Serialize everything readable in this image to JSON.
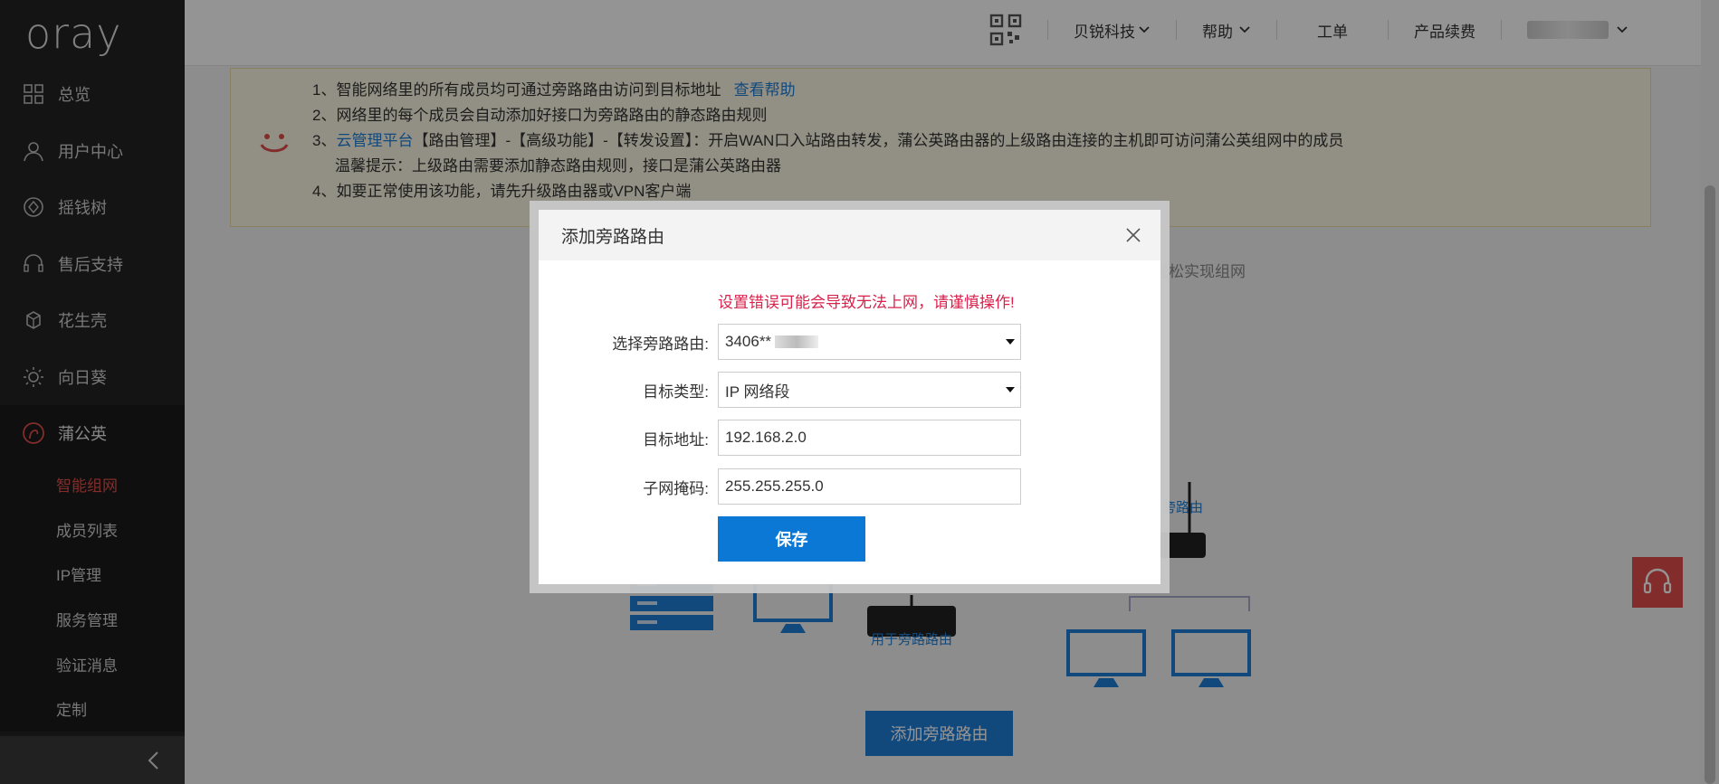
{
  "sidebar": {
    "logo": "oray",
    "items": [
      {
        "label": "总览",
        "icon": "grid-icon"
      },
      {
        "label": "用户中心",
        "icon": "user-icon"
      },
      {
        "label": "摇钱树",
        "icon": "coin-icon"
      },
      {
        "label": "售后支持",
        "icon": "headset-icon"
      },
      {
        "label": "花生壳",
        "icon": "shell-icon"
      },
      {
        "label": "向日葵",
        "icon": "sunflower-icon"
      },
      {
        "label": "蒲公英",
        "icon": "dandelion-icon"
      }
    ],
    "sub_items": [
      "智能组网",
      "成员列表",
      "IP管理",
      "服务管理",
      "验证消息",
      "定制"
    ],
    "active_sub": "智能组网"
  },
  "topbar": {
    "company": "贝锐科技",
    "help": "帮助",
    "ticket": "工单",
    "renew": "产品续费"
  },
  "notice": {
    "line1_text": "1、智能网络里的所有成员均可通过旁路路由访问到目标地址",
    "line1_link": "查看帮助",
    "line2": "2、网络里的每个成员会自动添加好接口为旁路路由的静态路由规则",
    "line3_prefix": "3、",
    "line3_link": "云管理平台",
    "line3_text": "【路由管理】-【高级功能】-【转发设置】：开启WAN口入站路由转发，蒲公英路由器的上级路由连接的主机即可访问蒲公英组网中的成员",
    "line3_tip": "温馨提示：上级路由需要添加静态路由规则，接口是蒲公英路由器",
    "line4": "4、如要正常使用该功能，请先升级路由器或VPN客户端"
  },
  "background": {
    "hint_partial": "轻松实现组网",
    "router_label_right": "旁路由",
    "router_label": "用于旁路路由",
    "add_button": "添加旁路路由"
  },
  "modal": {
    "title": "添加旁路路由",
    "warning": "设置错误可能会导致无法上网，请谨慎操作!",
    "fields": {
      "router_label": "选择旁路路由:",
      "router_value": "3406**",
      "type_label": "目标类型:",
      "type_value": "IP 网络段",
      "addr_label": "目标地址:",
      "addr_value": "192.168.2.0",
      "mask_label": "子网掩码:",
      "mask_value": "255.255.255.0"
    },
    "save": "保存"
  },
  "colors": {
    "accent_blue": "#1f7fd8",
    "warning_red": "#d9214b",
    "active_red": "#e14f4a"
  }
}
